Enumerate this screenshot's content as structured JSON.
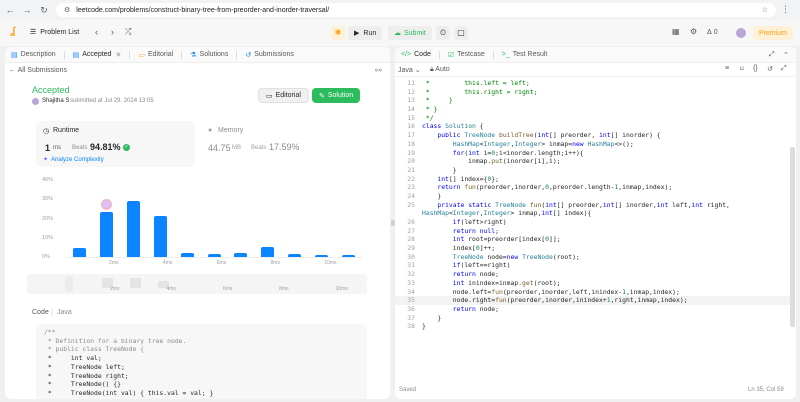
{
  "browser": {
    "url": "leetcode.com/problems/construct-binary-tree-from-preorder-and-inorder-traversal/"
  },
  "toolbar": {
    "problem_list": "Problem List",
    "run": "Run",
    "submit": "Submit",
    "premium": "Premium",
    "badge": "0"
  },
  "left": {
    "tabs": [
      {
        "label": "Description",
        "icon": "description-icon"
      },
      {
        "label": "Accepted",
        "icon": "accepted-icon"
      },
      {
        "label": "Editorial",
        "icon": "editorial-icon"
      },
      {
        "label": "Solutions",
        "icon": "solutions-icon"
      },
      {
        "label": "Submissions",
        "icon": "submissions-icon"
      }
    ],
    "back": "All Submissions",
    "status": "Accepted",
    "user": "Shajitha S",
    "submitted": "submitted at Jul 29, 2024 13:05",
    "editorial_btn": "Editorial",
    "solution_btn": "Solution",
    "runtime": {
      "label": "Runtime",
      "value": "1",
      "unit": "ms",
      "beats_label": "Beats",
      "beats": "94.81%",
      "analyze": "Analyze Complexity"
    },
    "memory": {
      "label": "Memory",
      "value": "44.75",
      "unit": "MB",
      "beats_label": "Beats",
      "beats": "17.59%"
    },
    "chart_data": {
      "type": "bar",
      "yticks": [
        "40%",
        "30%",
        "20%",
        "10%",
        "0%"
      ],
      "ylim": [
        0,
        40
      ],
      "values": [
        4.5,
        23.5,
        29,
        21.5,
        2,
        1.5,
        2,
        5,
        1.5,
        1,
        1
      ],
      "highlight_index": 1,
      "xticks": [
        "2ms",
        "4ms",
        "6ms",
        "8ms",
        "10ms"
      ],
      "overview_ticks": [
        "2ms",
        "4ms",
        "6ms",
        "8ms",
        "10ms"
      ],
      "overview_values": [
        0,
        4,
        4,
        3,
        0,
        0,
        0,
        0,
        0,
        0,
        0
      ]
    },
    "code_lang_tabs": [
      "Code",
      "Java"
    ],
    "code_lines": [
      "/**",
      " * Definition for a binary tree node.",
      " * public class TreeNode {",
      " *     int val;",
      " *     TreeNode left;",
      " *     TreeNode right;",
      " *     TreeNode() {}",
      " *     TreeNode(int val) { this.val = val; }"
    ]
  },
  "right": {
    "tabs": [
      {
        "label": "Code",
        "icon": "code-icon"
      },
      {
        "label": "Testcase",
        "icon": "testcase-icon"
      },
      {
        "label": "Test Result",
        "icon": "test-result-icon"
      }
    ],
    "lang": "Java",
    "auto": "Auto",
    "status_left": "Saved",
    "status_right": "Ln 35, Col 59",
    "lines": [
      {
        "n": "11",
        "t": " *         this.left = left;"
      },
      {
        "n": "12",
        "t": " *         this.right = right;"
      },
      {
        "n": "13",
        "t": " *     }"
      },
      {
        "n": "14",
        "t": " * }"
      },
      {
        "n": "15",
        "t": " */"
      },
      {
        "n": "16",
        "t": "class Solution {"
      },
      {
        "n": "17",
        "t": "    public TreeNode buildTree(int[] preorder, int[] inorder) {"
      },
      {
        "n": "18",
        "t": "        HashMap<Integer,Integer> inmap=new HashMap<>();"
      },
      {
        "n": "19",
        "t": "        for(int i=0;i<inorder.length;i++){"
      },
      {
        "n": "20",
        "t": "            inmap.put(inorder[i],i);"
      },
      {
        "n": "21",
        "t": "        }"
      },
      {
        "n": "22",
        "t": "    int[] index={0};"
      },
      {
        "n": "23",
        "t": "    return fun(preorder,inorder,0,preorder.length-1,inmap,index);"
      },
      {
        "n": "24",
        "t": "    }"
      },
      {
        "n": "25",
        "t": "    private static TreeNode fun(int[] preorder,int[] inorder,int left,int right,"
      },
      {
        "n": "",
        "t": "HashMap<Integer,Integer> inmap,int[] index){"
      },
      {
        "n": "26",
        "t": "        if(left>right)"
      },
      {
        "n": "27",
        "t": "        return null;"
      },
      {
        "n": "28",
        "t": "        int root=preorder[index[0]];"
      },
      {
        "n": "29",
        "t": "        index[0]++;"
      },
      {
        "n": "30",
        "t": "        TreeNode node=new TreeNode(root);"
      },
      {
        "n": "31",
        "t": "        if(left==right)"
      },
      {
        "n": "32",
        "t": "        return node;"
      },
      {
        "n": "33",
        "t": "        int inindex=inmap.get(root);"
      },
      {
        "n": "34",
        "t": "        node.left=fun(preorder,inorder,left,inindex-1,inmap,index);"
      },
      {
        "n": "35",
        "t": "        node.right=fun(preorder,inorder,inindex+1,right,inmap,index);"
      },
      {
        "n": "36",
        "t": "        return node;"
      },
      {
        "n": "37",
        "t": "    }"
      },
      {
        "n": "38",
        "t": "}"
      }
    ]
  },
  "colors": {
    "accent": "#2cbb5d",
    "bar": "#0a84ff",
    "bar_light": "#c4dcff"
  }
}
